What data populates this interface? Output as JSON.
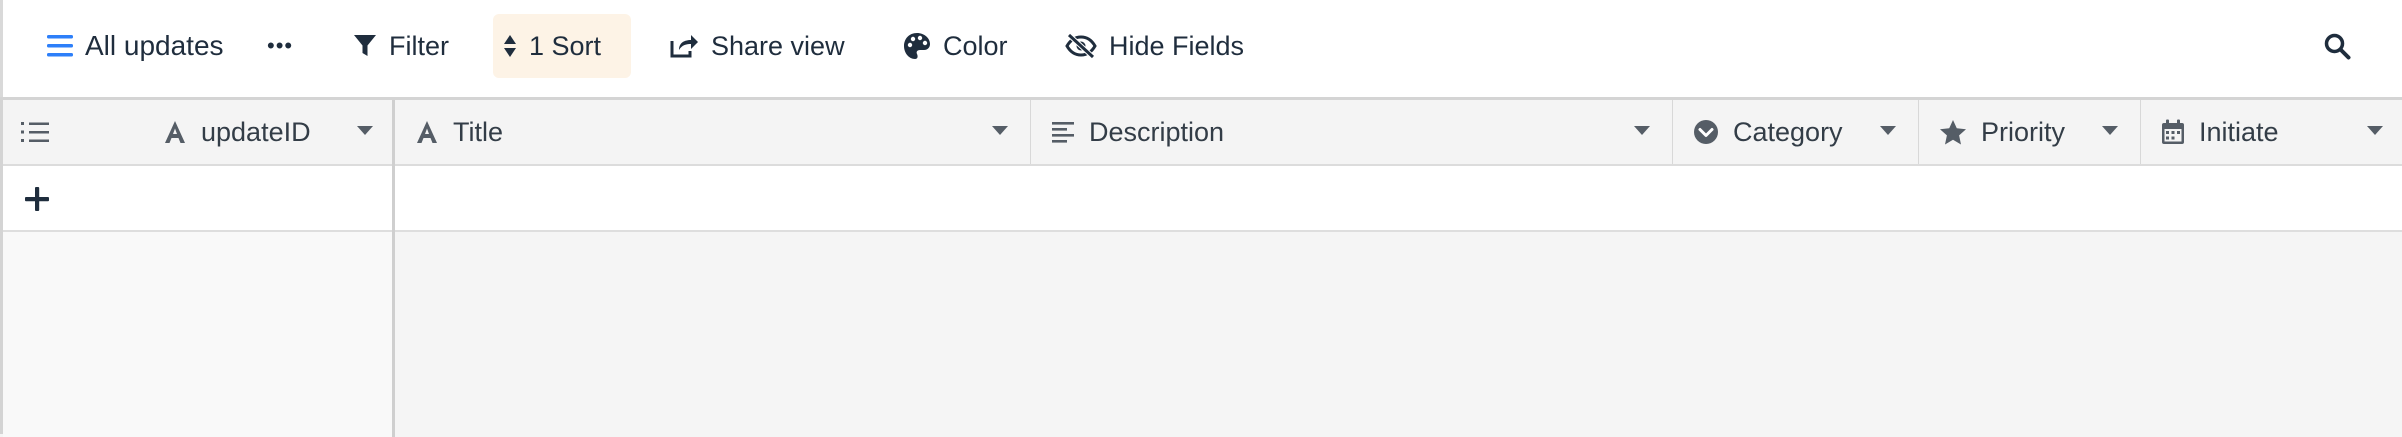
{
  "toolbar": {
    "view_name": "All updates",
    "more_label": "•••",
    "filter_label": "Filter",
    "sort_label": "1 Sort",
    "share_label": "Share view",
    "color_label": "Color",
    "hide_fields_label": "Hide Fields",
    "icons": {
      "view": "list-icon",
      "filter": "funnel-icon",
      "sort": "sort-arrows-icon",
      "share": "share-icon",
      "color": "palette-icon",
      "hide_fields": "eye-slash-icon",
      "search": "search-icon"
    },
    "accent_color": "#2d7ff9",
    "sort_active_bg": "#fdf3e6"
  },
  "grid": {
    "columns": [
      {
        "label": "updateID",
        "icon": "text-type-icon"
      },
      {
        "label": "Title",
        "icon": "text-type-icon"
      },
      {
        "label": "Description",
        "icon": "long-text-icon"
      },
      {
        "label": "Category",
        "icon": "single-select-icon"
      },
      {
        "label": "Priority",
        "icon": "star-icon"
      },
      {
        "label": "Initiate",
        "icon": "calendar-icon"
      }
    ],
    "row_number_icon": "numbered-list-icon",
    "add_row_icon": "plus-icon"
  }
}
